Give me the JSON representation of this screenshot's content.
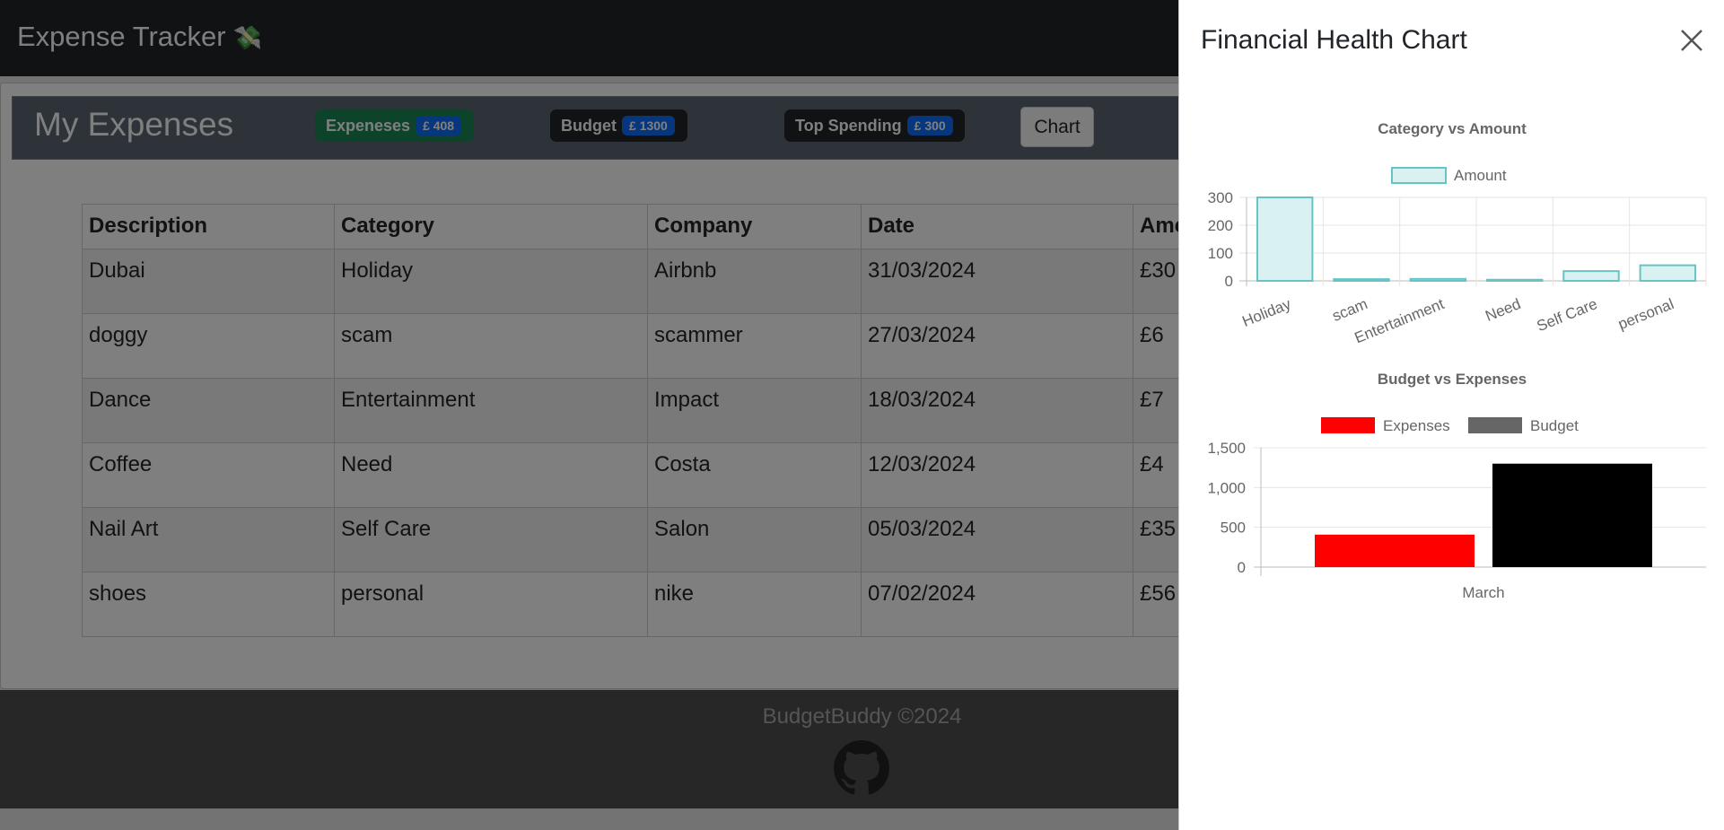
{
  "navbar": {
    "brand": "Expense Tracker",
    "brand_icon": "💸"
  },
  "header": {
    "title": "My Expenses",
    "badges": [
      {
        "label": "Expeneses",
        "value": "£ 408",
        "color": "#198754"
      },
      {
        "label": "Budget",
        "value": "£ 1300",
        "color": "#212529"
      },
      {
        "label": "Top Spending",
        "value": "£ 300",
        "color": "#212529"
      }
    ],
    "chart_button": "Chart"
  },
  "table": {
    "columns": [
      "Description",
      "Category",
      "Company",
      "Date",
      "Amc"
    ],
    "rows": [
      [
        "Dubai",
        "Holiday",
        "Airbnb",
        "31/03/2024",
        "£30"
      ],
      [
        "doggy",
        "scam",
        "scammer",
        "27/03/2024",
        "£6"
      ],
      [
        "Dance",
        "Entertainment",
        "Impact",
        "18/03/2024",
        "£7"
      ],
      [
        "Coffee",
        "Need",
        "Costa",
        "12/03/2024",
        "£4"
      ],
      [
        "Nail Art",
        "Self Care",
        "Salon",
        "05/03/2024",
        "£35"
      ],
      [
        "shoes",
        "personal",
        "nike",
        "07/02/2024",
        "£56"
      ]
    ]
  },
  "footer": {
    "text": "BudgetBuddy ©2024",
    "icon": "github-icon"
  },
  "offcanvas": {
    "title": "Financial Health Chart",
    "close_icon": "close-icon"
  },
  "colors": {
    "navbar": "#212529",
    "success": "#198754",
    "primary": "#0d6efd",
    "amount_bar_fill": "#d9f1f1",
    "amount_bar_stroke": "#66c4c4",
    "expenses_bar": "#ff0000",
    "budget_bar": "#000000"
  },
  "chart_data": [
    {
      "type": "bar",
      "title": "Category vs Amount",
      "categories": [
        "Holiday",
        "scam",
        "Entertainment",
        "Need",
        "Self Care",
        "personal"
      ],
      "series": [
        {
          "name": "Amount",
          "values": [
            300,
            6,
            7,
            4,
            35,
            56
          ]
        }
      ],
      "yticks": [
        "0",
        "100",
        "200",
        "300"
      ],
      "ylim": [
        0,
        300
      ],
      "legend": "top",
      "grid": true
    },
    {
      "type": "bar",
      "title": "Budget vs Expenses",
      "categories": [
        "March"
      ],
      "series": [
        {
          "name": "Expenses",
          "values": [
            408
          ]
        },
        {
          "name": "Budget",
          "values": [
            1300
          ]
        }
      ],
      "yticks": [
        "0",
        "500",
        "1,000",
        "1,500"
      ],
      "ylim": [
        0,
        1500
      ],
      "legend": "top",
      "grid": true
    }
  ]
}
